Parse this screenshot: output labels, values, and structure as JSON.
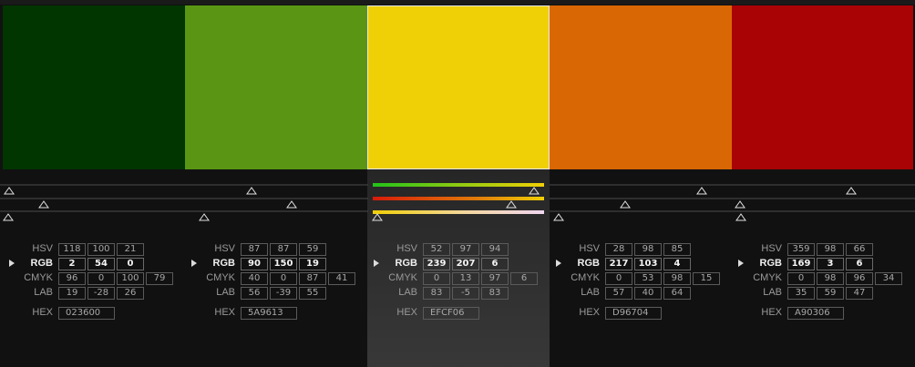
{
  "labels": {
    "hsv": "HSV",
    "rgb": "RGB",
    "cmyk": "CMYK",
    "lab": "LAB",
    "hex": "HEX"
  },
  "selected_index": 2,
  "colors": [
    {
      "swatch": "#023600",
      "hsv": [
        "118",
        "100",
        "21"
      ],
      "rgb": [
        "2",
        "54",
        "0"
      ],
      "cmyk": [
        "96",
        "0",
        "100",
        "79"
      ],
      "lab": [
        "19",
        "-28",
        "26"
      ],
      "hex": "023600"
    },
    {
      "swatch": "#5A9613",
      "hsv": [
        "87",
        "87",
        "59"
      ],
      "rgb": [
        "90",
        "150",
        "19"
      ],
      "cmyk": [
        "40",
        "0",
        "87",
        "41"
      ],
      "lab": [
        "56",
        "-39",
        "55"
      ],
      "hex": "5A9613"
    },
    {
      "swatch": "#EFCF06",
      "hsv": [
        "52",
        "97",
        "94"
      ],
      "rgb": [
        "239",
        "207",
        "6"
      ],
      "cmyk": [
        "0",
        "13",
        "97",
        "6"
      ],
      "lab": [
        "83",
        "-5",
        "83"
      ],
      "hex": "EFCF06"
    },
    {
      "swatch": "#D96704",
      "hsv": [
        "28",
        "98",
        "85"
      ],
      "rgb": [
        "217",
        "103",
        "4"
      ],
      "cmyk": [
        "0",
        "53",
        "98",
        "15"
      ],
      "lab": [
        "57",
        "40",
        "64"
      ],
      "hex": "D96704"
    },
    {
      "swatch": "#A90306",
      "hsv": [
        "359",
        "98",
        "66"
      ],
      "rgb": [
        "169",
        "3",
        "6"
      ],
      "cmyk": [
        "0",
        "98",
        "96",
        "34"
      ],
      "lab": [
        "35",
        "59",
        "47"
      ],
      "hex": "A90306"
    }
  ]
}
